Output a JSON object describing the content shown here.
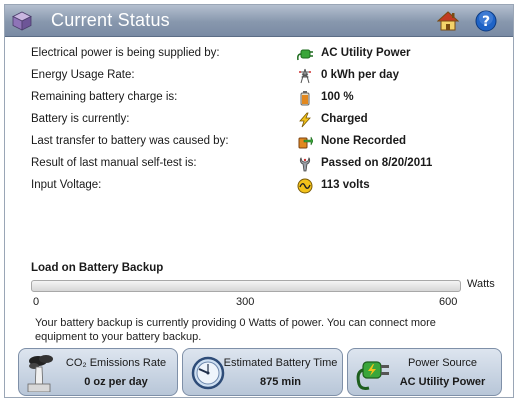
{
  "header": {
    "title": "Current Status",
    "app_icon": "cube-icon",
    "home_icon": "home-icon",
    "help_icon": "help-icon"
  },
  "status": [
    {
      "label": "Electrical power is being supplied by:",
      "value": "AC Utility Power",
      "icon": "plug-icon"
    },
    {
      "label": "Energy Usage Rate:",
      "value": "0 kWh per day",
      "icon": "power-tower-icon"
    },
    {
      "label": "Remaining battery charge is:",
      "value": "100 %",
      "icon": "battery-icon"
    },
    {
      "label": "Battery is currently:",
      "value": "Charged",
      "icon": "lightning-icon"
    },
    {
      "label": "Last transfer to battery was caused by:",
      "value": "None Recorded",
      "icon": "transfer-icon"
    },
    {
      "label": "Result of last manual self-test is:",
      "value": "Passed on 8/20/2011",
      "icon": "wrench-icon"
    },
    {
      "label": "Input Voltage:",
      "value": "113 volts",
      "icon": "voltage-icon"
    }
  ],
  "load": {
    "title": "Load on Battery Backup",
    "unit": "Watts",
    "ticks": [
      "0",
      "300",
      "600"
    ],
    "current_watts": 0,
    "max_watts": 600
  },
  "message": "Your battery backup is currently providing 0 Watts of power. You can connect more equipment to your battery backup.",
  "cards": [
    {
      "title": "CO₂ Emissions Rate",
      "value": "0 oz per day",
      "icon": "factory-smoke-icon"
    },
    {
      "title": "Estimated Battery Time",
      "value": "875 min",
      "icon": "clock-icon"
    },
    {
      "title": "Power Source",
      "value": "AC Utility Power",
      "icon": "plug-icon"
    }
  ],
  "colors": {
    "header_start": "#b4bfcf",
    "header_end": "#7a8ba4",
    "load_fill": "#6fa9d8",
    "help_blue": "#1f63c6",
    "plug_green": "#3aa63a"
  }
}
